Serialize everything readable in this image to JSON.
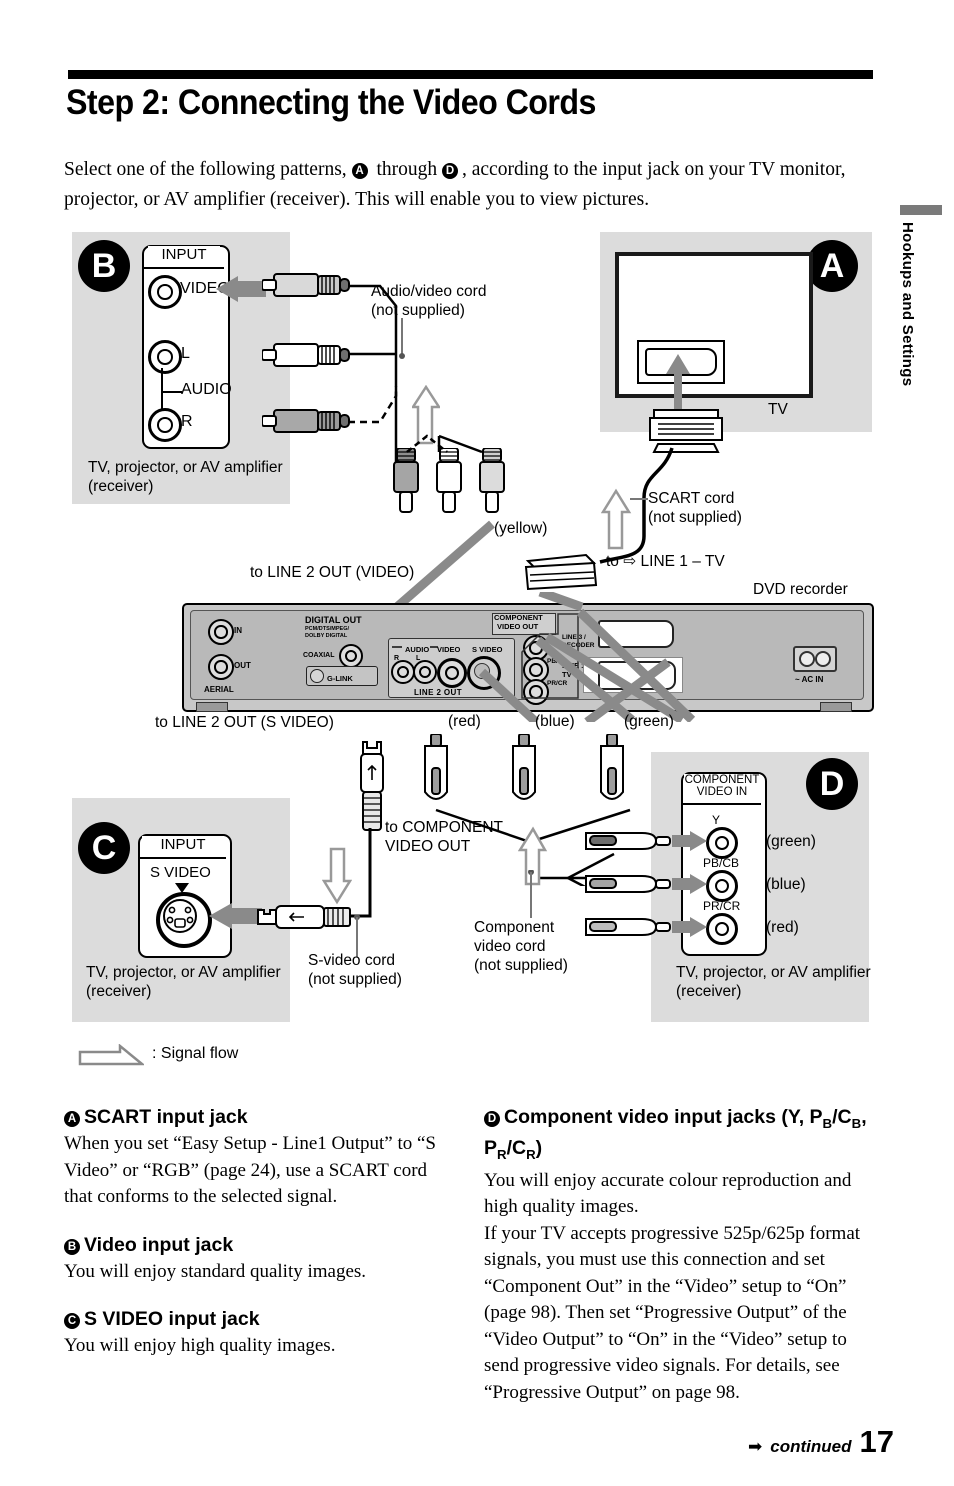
{
  "header": {
    "title": "Step 2: Connecting the Video Cords",
    "intro_1": "Select one of the following patterns, ",
    "intro_badge_a": "A",
    "intro_2": " through ",
    "intro_badge_d": "D",
    "intro_3": ", according to the input jack on your TV monitor, projector, or AV amplifier (receiver). This will enable you to view pictures."
  },
  "side_tab": {
    "label": "Hookups and Settings"
  },
  "diagram": {
    "panel_b": {
      "badge": "B",
      "jack_header": "INPUT",
      "jacks": [
        "VIDEO",
        "L",
        "R"
      ],
      "audio_label": "AUDIO",
      "caption": "TV, projector, or AV amplifier (receiver)"
    },
    "panel_a": {
      "badge": "A",
      "tv_label": "TV"
    },
    "panel_c": {
      "badge": "C",
      "jack_header": "INPUT",
      "jack_label": "S VIDEO",
      "caption": "TV, projector, or AV amplifier (receiver)"
    },
    "panel_d": {
      "badge": "D",
      "jack_header_1": "COMPONENT",
      "jack_header_2": "VIDEO IN",
      "jacks": [
        {
          "name": "Y",
          "sub": "",
          "colour": "(green)"
        },
        {
          "name": "PB/CB",
          "sub": "",
          "colour": "(blue)"
        },
        {
          "name": "PR/CR",
          "sub": "",
          "colour": "(red)"
        }
      ],
      "caption": "TV, projector, or AV amplifier (receiver)"
    },
    "labels": {
      "av_cord": "Audio/video cord\n(not supplied)",
      "av_cord_l1": "Audio/video cord",
      "av_cord_l2": "(not supplied)",
      "yellow": "(yellow)",
      "to_line2_video": "to LINE 2 OUT (VIDEO)",
      "scart_cord_l1": "SCART cord",
      "scart_cord_l2": "(not supplied)",
      "to_line1_tv": "to ⇨ LINE 1 – TV",
      "dvd_recorder": "DVD recorder",
      "to_line2_svideo": "to LINE 2 OUT (S VIDEO)",
      "red": "(red)",
      "blue": "(blue)",
      "green": "(green)",
      "to_component_l1": "to COMPONENT",
      "to_component_l2": "VIDEO OUT",
      "svideo_cord_l1": "S-video cord",
      "svideo_cord_l2": "(not supplied)",
      "component_cord_l1": "Component",
      "component_cord_l2": "video cord",
      "component_cord_l3": "(not supplied)",
      "signal_flow": ": Signal flow"
    },
    "recorder": {
      "aerial": "AERIAL",
      "aerial_in": "IN",
      "aerial_out": "OUT",
      "digital_out_1": "DIGITAL OUT",
      "digital_out_2": "PCM/DTS/MPEG/",
      "digital_out_3": "DOLBY DIGITAL",
      "coaxial": "COAXIAL",
      "g_link": "G-LINK",
      "audio": "AUDIO",
      "audio_r": "R",
      "audio_l": "L",
      "video": "VIDEO",
      "s_video": "S VIDEO",
      "line2_out": "LINE 2 OUT",
      "component_1": "COMPONENT",
      "component_2": "VIDEO OUT",
      "comp_y": "Y",
      "comp_pb": "PB/CB",
      "comp_pr": "PR/CR",
      "line3_1": "LINE 3 /",
      "line3_2": "DECODER",
      "line1_1": "LINE 1 -",
      "line1_2": "TV",
      "ac_in": "~ AC IN"
    }
  },
  "bottom": {
    "left": [
      {
        "badge": "A",
        "heading": "SCART input jack",
        "body": "When you set “Easy Setup - Line1 Output” to “S Video” or “RGB” (page 24), use a SCART cord that conforms to the selected signal."
      },
      {
        "badge": "B",
        "heading": "Video input jack",
        "body": "You will enjoy standard quality images."
      },
      {
        "badge": "C",
        "heading": "S VIDEO input jack",
        "body": "You will enjoy high quality images."
      }
    ],
    "right": {
      "badge": "D",
      "heading_1": "Component video input jacks (Y, P",
      "heading_sub_1": "B",
      "heading_2": "/C",
      "heading_sub_2": "B",
      "heading_3": ", P",
      "heading_sub_3": "R",
      "heading_4": "/C",
      "heading_sub_4": "R",
      "heading_5": ")",
      "body_1": "You will enjoy accurate colour reproduction and high quality images.",
      "body_2": "If your TV accepts progressive 525p/625p format signals, you must use this connection and set “Component Out” in the “Video” setup to “On” (page 98). Then set “Progressive Output” of the “Video Output” to “On” in the “Video” setup to send progressive video signals. For details, see “Progressive Output” on page 98."
    }
  },
  "footer": {
    "continued": "continued",
    "page_number": "17"
  }
}
